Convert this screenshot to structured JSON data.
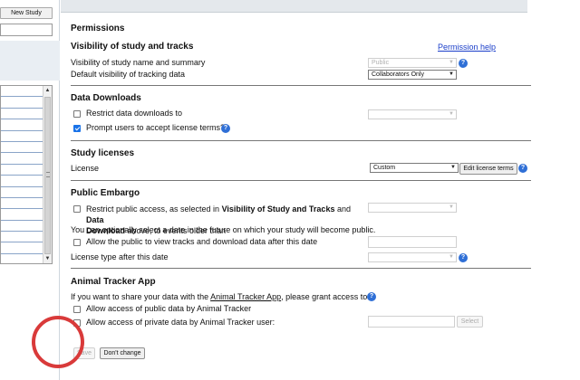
{
  "sidebar": {
    "new_study_label": "New Study",
    "list_rows": 15
  },
  "page": {
    "title": "Permissions"
  },
  "visibility": {
    "title": "Visibility of study and tracks",
    "permission_help": "Permission help",
    "name_summary_label": "Visibility of study name and summary",
    "name_summary_value": "Public",
    "tracking_label": "Default visibility of tracking data",
    "tracking_value": "Collaborators Only"
  },
  "downloads": {
    "title": "Data Downloads",
    "restrict_label": "Restrict data downloads to",
    "restrict_value": "",
    "prompt_label": "Prompt users to accept license terms?",
    "prompt_checked": true
  },
  "licenses": {
    "title": "Study licenses",
    "license_label": "License",
    "license_value": "Custom",
    "edit_button": "Edit license terms"
  },
  "embargo": {
    "title": "Public Embargo",
    "restrict_part1": "Restrict public access, as selected in ",
    "restrict_bold1": "Visibility of Study and Tracks",
    "restrict_part2": " and ",
    "restrict_bold2a": "Data",
    "restrict_bold2b": "Download",
    "restrict_part3": " above, to events older than",
    "optional_text": "You can optionally select a date in the future on which your study will become public.",
    "allow_label": "Allow the public to view tracks and download data after this date",
    "license_after_label": "License type after this date"
  },
  "tracker": {
    "title": "Animal Tracker App",
    "intro_part1": "If you want to share your data with the ",
    "intro_link": "Animal Tracker App",
    "intro_part2": ", please grant access to it.",
    "public_label": "Allow access of public data by Animal Tracker",
    "private_label": "Allow access of private data by Animal Tracker user:",
    "select_button": "Select"
  },
  "actions": {
    "save": "Save",
    "dont_change": "Don't change"
  },
  "colors": {
    "accent": "#1a73e8",
    "help_icon": "#2f6fd6",
    "link": "#1a3ec9",
    "annotation_circle": "#d93a3a"
  }
}
